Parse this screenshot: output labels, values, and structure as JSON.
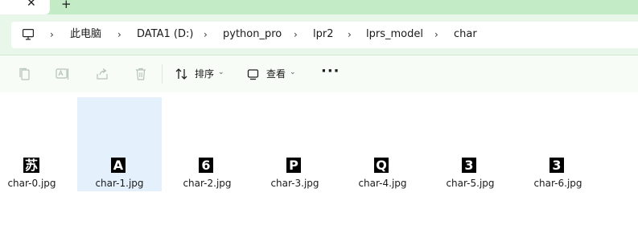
{
  "tabs": {
    "close_glyph": "✕",
    "new_tab_glyph": "+"
  },
  "breadcrumb": {
    "items": [
      "此电脑",
      "DATA1 (D:)",
      "python_pro",
      "lpr2",
      "lprs_model",
      "char"
    ],
    "separator": "›"
  },
  "commandbar": {
    "sort_label": "排序",
    "view_label": "查看",
    "more_label": "···",
    "chevron": "⌄",
    "icons": [
      "copy-icon",
      "rename-icon",
      "share-icon",
      "delete-icon",
      "sort-icon",
      "view-icon"
    ]
  },
  "files": [
    {
      "name": "char-0.jpg",
      "glyph": "苏"
    },
    {
      "name": "char-1.jpg",
      "glyph": "A"
    },
    {
      "name": "char-2.jpg",
      "glyph": "6"
    },
    {
      "name": "char-3.jpg",
      "glyph": "P"
    },
    {
      "name": "char-4.jpg",
      "glyph": "Q"
    },
    {
      "name": "char-5.jpg",
      "glyph": "3"
    },
    {
      "name": "char-6.jpg",
      "glyph": "3"
    }
  ],
  "colors": {
    "tabstrip": "#c3ecc6",
    "addressbar": "#e8f7ea",
    "selection": "#e4f1fd"
  }
}
